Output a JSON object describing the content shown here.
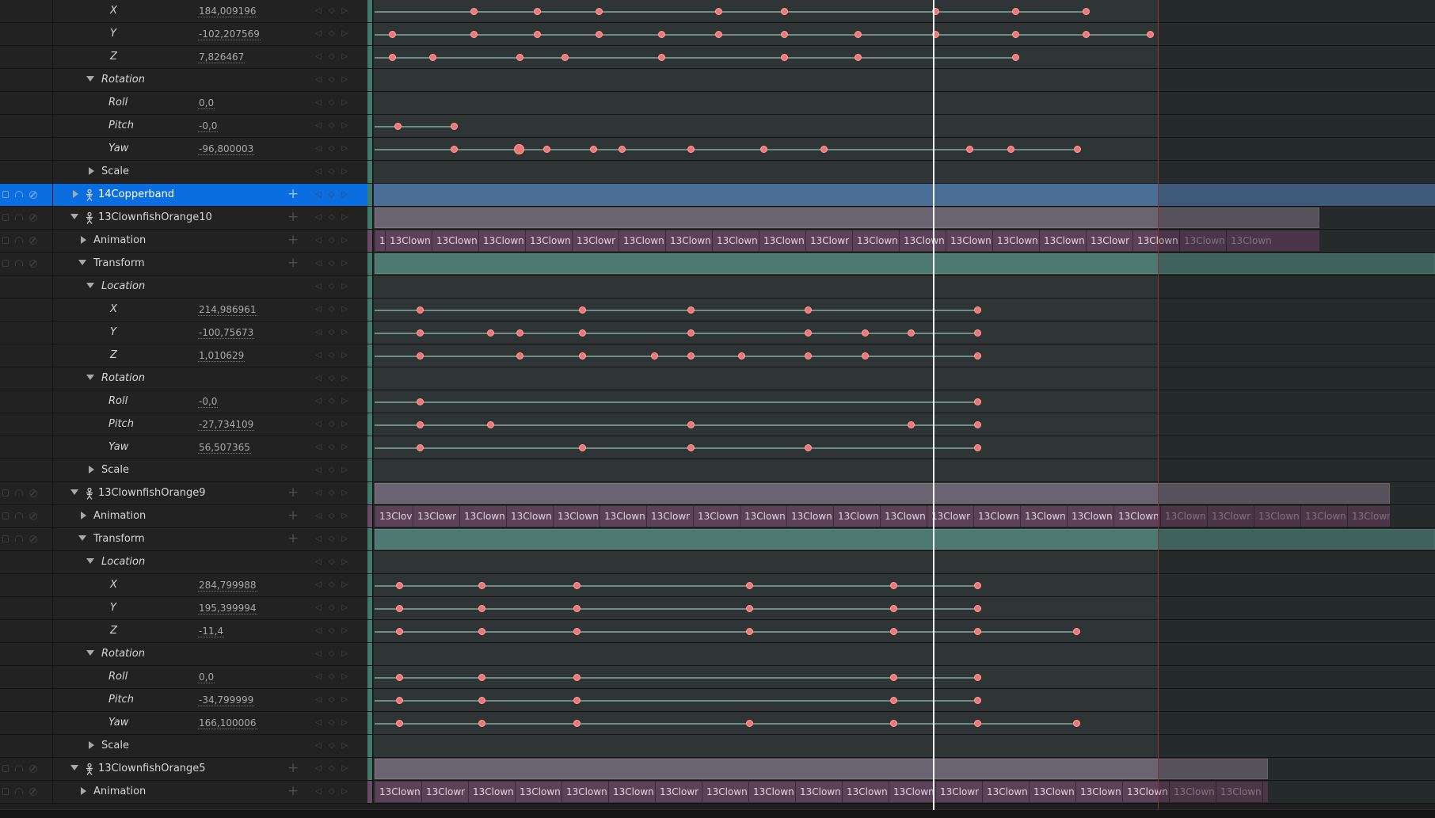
{
  "colors": {
    "selection": "#0b6ee0",
    "keyframe": "#f07575",
    "playhead": "#f3f3f3",
    "end_marker": "#8a3338"
  },
  "icons": {
    "lock": "lock-icon",
    "solo": "headphones-icon",
    "mute": "mute-icon",
    "key_prev": "previous-key-icon",
    "key_add": "add-key-icon",
    "key_next": "next-key-icon",
    "add_track": "plus-icon",
    "actor": "skeletal-mesh-icon"
  },
  "tracks": [
    {
      "type": "channel",
      "indent": 2,
      "label": "X",
      "value": "184,009196",
      "keys": [
        598,
        678,
        756,
        907,
        990,
        1181,
        1282,
        1371
      ]
    },
    {
      "type": "channel",
      "indent": 2,
      "label": "Y",
      "value": "-102,207569",
      "keys": [
        495,
        598,
        678,
        756,
        835,
        907,
        990,
        1083,
        1181,
        1282,
        1371,
        1452
      ]
    },
    {
      "type": "channel",
      "indent": 2,
      "label": "Z",
      "value": "7,826467",
      "keys": [
        495,
        546,
        656,
        713,
        835,
        990,
        1083,
        1282
      ]
    },
    {
      "type": "group",
      "indent": 1,
      "label": "Rotation",
      "expanded": true,
      "italic": true
    },
    {
      "type": "channel",
      "indent": 2,
      "label": "Roll",
      "value": "0,0",
      "keys": []
    },
    {
      "type": "channel",
      "indent": 2,
      "label": "Pitch",
      "value": "-0,0",
      "keys": [
        502,
        573
      ]
    },
    {
      "type": "channel",
      "indent": 2,
      "label": "Yaw",
      "value": "-96,800003",
      "keys": [
        573,
        655,
        690,
        749,
        785,
        872,
        964,
        1040,
        1224,
        1276,
        1360
      ],
      "big": [
        655
      ]
    },
    {
      "type": "group",
      "indent": 1,
      "label": "Scale",
      "expanded": false,
      "italic": false
    },
    {
      "type": "actor",
      "label": "14Copperband",
      "expanded": false,
      "selected": true
    },
    {
      "type": "actor",
      "label": "13ClownfishOrange10",
      "expanded": true,
      "bar_end": 1666
    },
    {
      "type": "anim",
      "label": "Animation",
      "cells": [
        "1",
        "13Clown",
        "13Clown",
        "13Clown",
        "13Clown",
        "13Clowr",
        "13Clown",
        "13Clown",
        "13Clown",
        "13Clown",
        "13Clowr",
        "13Clown",
        "13Clown",
        "13Clown",
        "13Clown",
        "13Clown",
        "13Clowr",
        "13Clown",
        "13Clown",
        "13Clown"
      ],
      "cell_widths": [
        13,
        59,
        59,
        59,
        59,
        59,
        59,
        59,
        59,
        59,
        59,
        59,
        59,
        59,
        59,
        59,
        59,
        59,
        59,
        59
      ],
      "bar_end": 1666
    },
    {
      "type": "transform",
      "label": "Transform",
      "expanded": true
    },
    {
      "type": "group",
      "indent": 1,
      "label": "Location",
      "expanded": true,
      "italic": true
    },
    {
      "type": "channel",
      "indent": 2,
      "label": "X",
      "value": "214,986961",
      "keys": [
        530,
        735,
        872,
        1020,
        1234
      ]
    },
    {
      "type": "channel",
      "indent": 2,
      "label": "Y",
      "value": "-100,75673",
      "keys": [
        530,
        619,
        656,
        735,
        872,
        1020,
        1092,
        1150,
        1234
      ]
    },
    {
      "type": "channel",
      "indent": 2,
      "label": "Z",
      "value": "1,010629",
      "keys": [
        530,
        656,
        735,
        826,
        872,
        936,
        1020,
        1092,
        1234
      ]
    },
    {
      "type": "group",
      "indent": 1,
      "label": "Rotation",
      "expanded": true,
      "italic": true
    },
    {
      "type": "channel",
      "indent": 2,
      "label": "Roll",
      "value": "-0,0",
      "keys": [
        530,
        1234
      ]
    },
    {
      "type": "channel",
      "indent": 2,
      "label": "Pitch",
      "value": "-27,734109",
      "keys": [
        530,
        619,
        872,
        1150,
        1234
      ]
    },
    {
      "type": "channel",
      "indent": 2,
      "label": "Yaw",
      "value": "56,507365",
      "keys": [
        530,
        735,
        872,
        1020,
        1234
      ]
    },
    {
      "type": "group",
      "indent": 1,
      "label": "Scale",
      "expanded": false,
      "italic": false
    },
    {
      "type": "actor",
      "label": "13ClownfishOrange9",
      "expanded": true,
      "bar_end": 1755
    },
    {
      "type": "anim",
      "label": "Animation",
      "cells": [
        "13Clov",
        "13Clowr",
        "13Clown",
        "13Clown",
        "13Clown",
        "13Clown",
        "13Clowr",
        "13Clown",
        "13Clown",
        "13Clown",
        "13Clown",
        "13Clown",
        "13Clowr",
        "13Clown",
        "13Clown",
        "13Clown",
        "13Clown",
        "13Clown",
        "13Clowr",
        "13Clown",
        "13Clown",
        "13Clown"
      ],
      "cell_widths": [
        48,
        59,
        59,
        59,
        59,
        59,
        59,
        59,
        59,
        59,
        59,
        59,
        59,
        59,
        59,
        59,
        59,
        59,
        59,
        59,
        59,
        59
      ],
      "bar_end": 1755
    },
    {
      "type": "transform",
      "label": "Transform",
      "expanded": true
    },
    {
      "type": "group",
      "indent": 1,
      "label": "Location",
      "expanded": true,
      "italic": true
    },
    {
      "type": "channel",
      "indent": 2,
      "label": "X",
      "value": "284,799988",
      "keys": [
        504,
        608,
        728,
        946,
        1128,
        1234
      ]
    },
    {
      "type": "channel",
      "indent": 2,
      "label": "Y",
      "value": "195,399994",
      "keys": [
        504,
        608,
        728,
        946,
        1128,
        1234
      ]
    },
    {
      "type": "channel",
      "indent": 2,
      "label": "Z",
      "value": "-11,4",
      "keys": [
        504,
        608,
        728,
        946,
        1128,
        1234,
        1359
      ]
    },
    {
      "type": "group",
      "indent": 1,
      "label": "Rotation",
      "expanded": true,
      "italic": true
    },
    {
      "type": "channel",
      "indent": 2,
      "label": "Roll",
      "value": "0,0",
      "keys": [
        504,
        608,
        728,
        1128,
        1234
      ]
    },
    {
      "type": "channel",
      "indent": 2,
      "label": "Pitch",
      "value": "-34,799999",
      "keys": [
        504,
        608,
        728,
        1128,
        1234
      ]
    },
    {
      "type": "channel",
      "indent": 2,
      "label": "Yaw",
      "value": "166,100006",
      "keys": [
        504,
        608,
        728,
        946,
        1128,
        1234,
        1359
      ]
    },
    {
      "type": "group",
      "indent": 1,
      "label": "Scale",
      "expanded": false,
      "italic": false
    },
    {
      "type": "actor",
      "label": "13ClownfishOrange5",
      "expanded": true,
      "bar_end": 1601
    },
    {
      "type": "anim",
      "label": "Animation",
      "cells": [
        "13Clown",
        "13Clowr",
        "13Clown",
        "13Clown",
        "13Clown",
        "13Clown",
        "13Clowr",
        "13Clown",
        "13Clown",
        "13Clown",
        "13Clown",
        "13Clown",
        "13Clowr",
        "13Clown",
        "13Clown",
        "13Clown",
        "13Clown",
        "13Clown",
        "13Clown",
        "13Clown"
      ],
      "cell_widths": [
        59,
        59,
        59,
        59,
        59,
        59,
        59,
        59,
        59,
        59,
        59,
        59,
        59,
        59,
        59,
        59,
        59,
        59,
        59,
        59
      ],
      "bar_end": 1601
    }
  ]
}
